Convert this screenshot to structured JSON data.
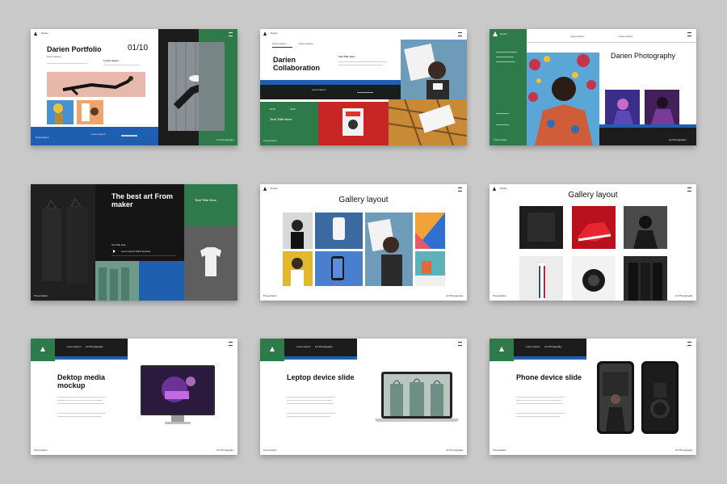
{
  "slides": [
    {
      "brand": "Darien",
      "title": "Darien Portfolio",
      "page": "01/10",
      "lorem": "Lorem ipsum",
      "subtitle": "Lorem ipsum",
      "footer_left": "Presentation",
      "footer_right": "Art Photography",
      "cta": "Lorem ipsum"
    },
    {
      "brand": "Darien",
      "tab1": "Lorem ipsum",
      "tab2": "Lorem ipsum",
      "title": "Darien Collaboration",
      "subtitle": "Text Title Here",
      "lorem": "Lorem ipsum",
      "year1": "2018",
      "year2": "2020",
      "section": "Text Title Here",
      "footer_left": "Presentation"
    },
    {
      "brand": "Darien",
      "title": "Darien Photography",
      "tag1": "Lorem ipsum",
      "tag2": "Lorem ipsum",
      "footer_left": "Presentation",
      "footer_right": "Art Photography"
    },
    {
      "title": "The best art From maker",
      "subtitle": "Text Title Here",
      "caption": "Text title here",
      "item": "Lorem ipsum dolor sit amet",
      "footer_left": "Presentation"
    },
    {
      "brand": "Darien",
      "title": "Gallery layout",
      "footer_left": "Presentation",
      "footer_right": "Art Photography"
    },
    {
      "brand": "Darien",
      "title": "Gallery layout",
      "footer_left": "Presentation",
      "footer_right": "Art Photography"
    },
    {
      "title": "Dektop media mockup",
      "tab1": "Lorem ipsum",
      "tab2": "Art Photography",
      "footer_left": "Presentation",
      "footer_right": "Art Photography"
    },
    {
      "title": "Leptop device slide",
      "tab1": "Lorem ipsum",
      "tab2": "Art Photography",
      "footer_left": "Presentation",
      "footer_right": "Art Photography"
    },
    {
      "title": "Phone device slide",
      "tab1": "Lorem ipsum",
      "tab2": "Art Photography",
      "footer_left": "Presentation",
      "footer_right": "Art Photography"
    }
  ],
  "colors": {
    "background": "#c9c9c9",
    "green": "#2f7a4a",
    "blue": "#1f5fb0",
    "dark": "#1c1c1c"
  }
}
